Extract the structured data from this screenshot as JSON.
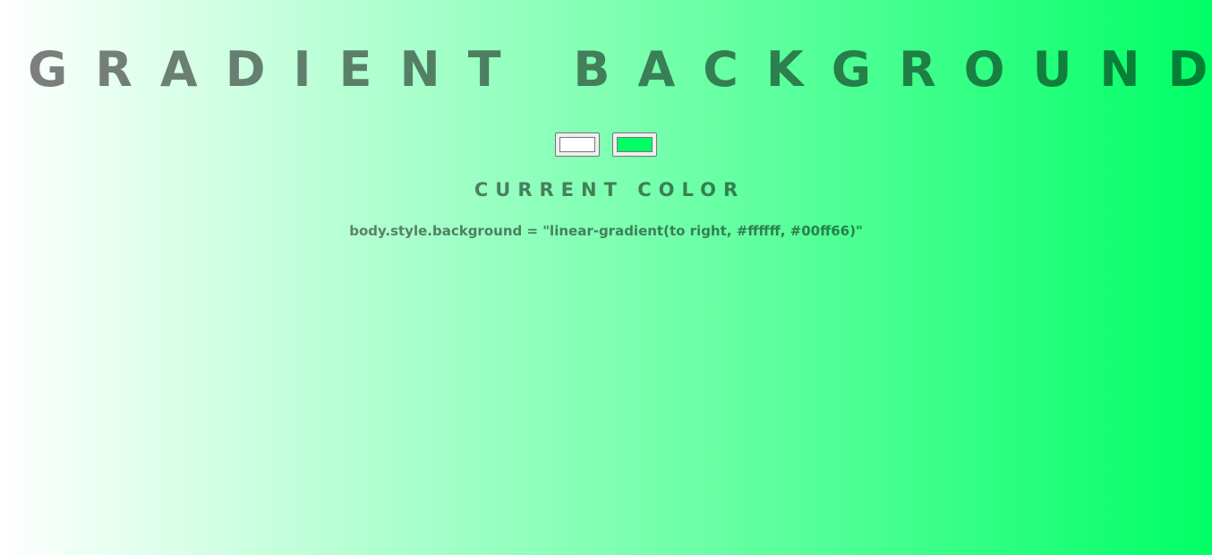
{
  "page": {
    "title": "GRADIENT BACKGROUND",
    "subtitle": "CURRENT COLOR",
    "css_readout": "body.style.background = \"linear-gradient(to right, #ffffff, #00ff66)\""
  },
  "pickers": {
    "color1": {
      "value": "#ffffff"
    },
    "color2": {
      "value": "#00ff66"
    }
  },
  "colors": {
    "gradient_start": "#ffffff",
    "gradient_end": "#00ff66",
    "text": "rgba(0,0,0,0.5)"
  }
}
